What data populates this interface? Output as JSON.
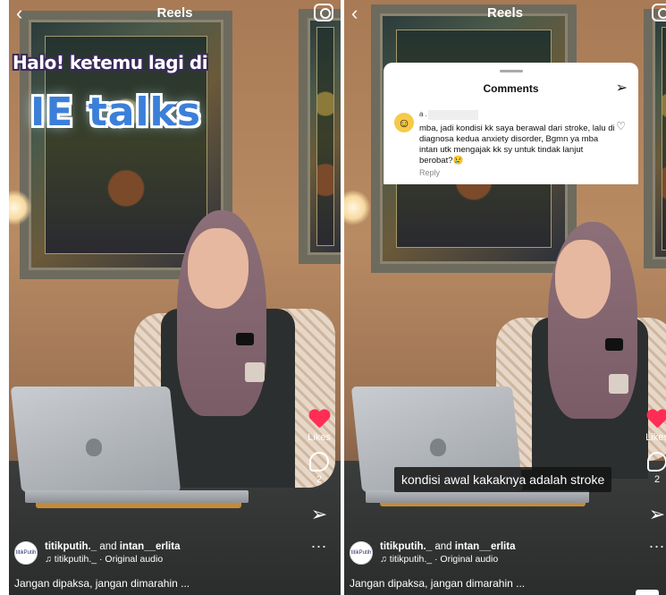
{
  "left": {
    "header": {
      "title": "Reels"
    },
    "overlay": {
      "line1": "Halo! ketemu lagi di",
      "line2": "IE talks"
    },
    "actions": {
      "likes_label": "Likes",
      "comments_count": "2",
      "more": "..."
    },
    "post": {
      "author_1": "titikputih._",
      "and": "and",
      "author_2": "intan__erlita",
      "audio": "titikputih._ · Original audio",
      "caption": "Jangan dipaksa, jangan dimarahin ...",
      "avatar_text": "titikPutih"
    }
  },
  "right": {
    "header": {
      "title": "Reels"
    },
    "comments_sheet": {
      "title": "Comments",
      "commenter": "a .",
      "comment_text": "mba, jadi kondisi kk saya berawal dari stroke, lalu di diagnosa kedua anxiety disorder, Bgmn ya mba intan utk mengajak kk sy untuk tindak lanjut berobat?😢",
      "reply_label": "Reply",
      "emoji": "☺"
    },
    "subtitle": "kondisi awal kakaknya adalah stroke",
    "actions": {
      "likes_label": "Likes",
      "comments_count": "2",
      "more": "..."
    },
    "post": {
      "author_1": "titikputih._",
      "and": "and",
      "author_2": "intan__erlita",
      "audio": "titikputih._ · Original audio",
      "caption": "Jangan dipaksa, jangan dimarahin ...",
      "avatar_text": "titikPutih"
    }
  },
  "icons": {
    "back": "chevron-left-icon",
    "camera": "camera-icon",
    "heart": "heart-icon",
    "comment": "comment-icon",
    "send": "send-icon",
    "music": "music-note-icon"
  },
  "colors": {
    "heart": "#ff2d55",
    "overlay_blue": "#3c7fd8",
    "sheet_bg": "#ffffff"
  }
}
